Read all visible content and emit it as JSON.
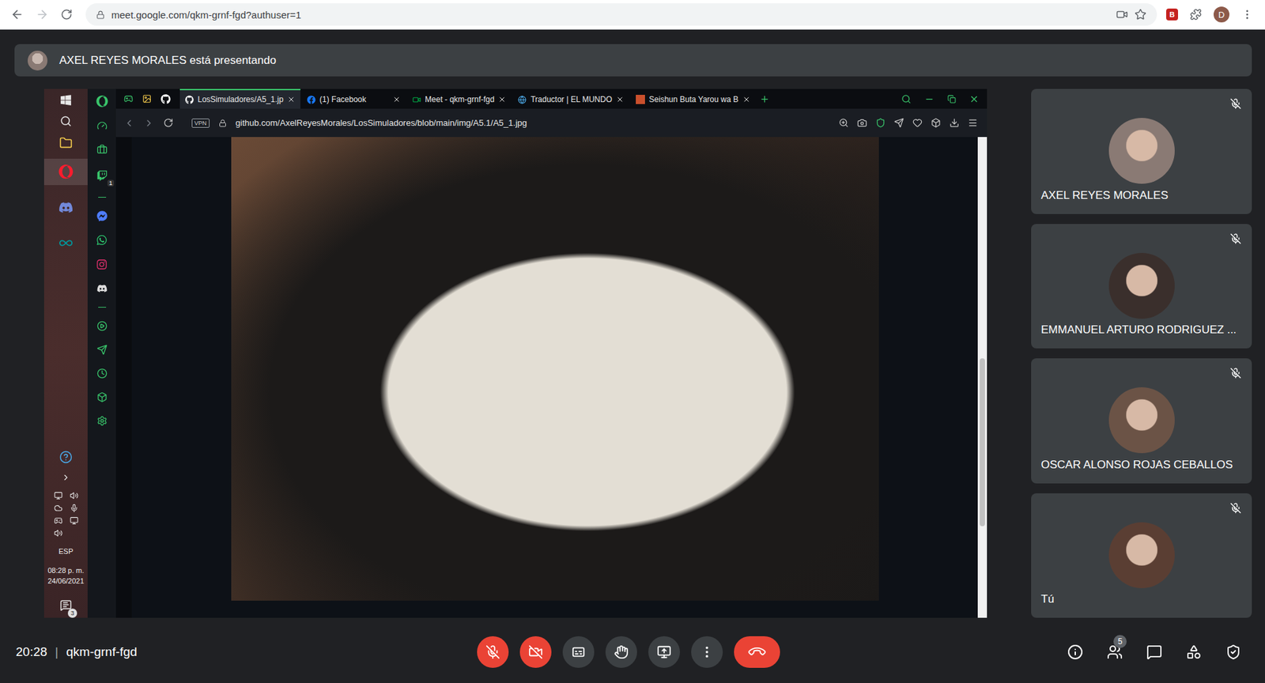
{
  "browser": {
    "url": "meet.google.com/qkm-grnf-fgd?authuser=1",
    "extension_badge": "B",
    "profile_initial": "D"
  },
  "banner": {
    "presenter_text": "AXEL REYES MORALES está presentando"
  },
  "shared_screen": {
    "taskbar": {
      "language": "ESP",
      "time": "08:28 p. m.",
      "date": "24/06/2021",
      "notification_count": "3"
    },
    "sidebar": {
      "twitch_badge": "1"
    },
    "tabs": [
      {
        "label": "LosSimuladores/A5_1.jp",
        "kind": "github",
        "selected": true
      },
      {
        "label": "(1) Facebook",
        "kind": "facebook",
        "selected": false
      },
      {
        "label": "Meet - qkm-grnf-fgd",
        "kind": "meet",
        "selected": false
      },
      {
        "label": "Traductor | EL MUNDO",
        "kind": "globe",
        "selected": false
      },
      {
        "label": "Seishun Buta Yarou wa B",
        "kind": "anime",
        "selected": false
      }
    ],
    "address": {
      "vpn": "VPN",
      "url": "github.com/AxelReyesMorales/LosSimuladores/blob/main/img/A5.1/A5_1.jpg"
    },
    "scroll_thumb": {
      "start": 0.46,
      "size": 0.35
    }
  },
  "participants": [
    {
      "name": "AXEL REYES MORALES",
      "muted": true,
      "color": "#8a7a74"
    },
    {
      "name": "EMMANUEL ARTURO RODRIGUEZ ...",
      "muted": true,
      "color": "#3a2f2c"
    },
    {
      "name": "OSCAR ALONSO ROJAS CEBALLOS",
      "muted": true,
      "color": "#6b5346"
    },
    {
      "name": "Tú",
      "muted": true,
      "color": "#5a3e33"
    }
  ],
  "bottom_bar": {
    "time": "20:28",
    "separator": "|",
    "meeting_code": "qkm-grnf-fgd",
    "mic_on": false,
    "camera_on": false,
    "participant_count": "5"
  }
}
